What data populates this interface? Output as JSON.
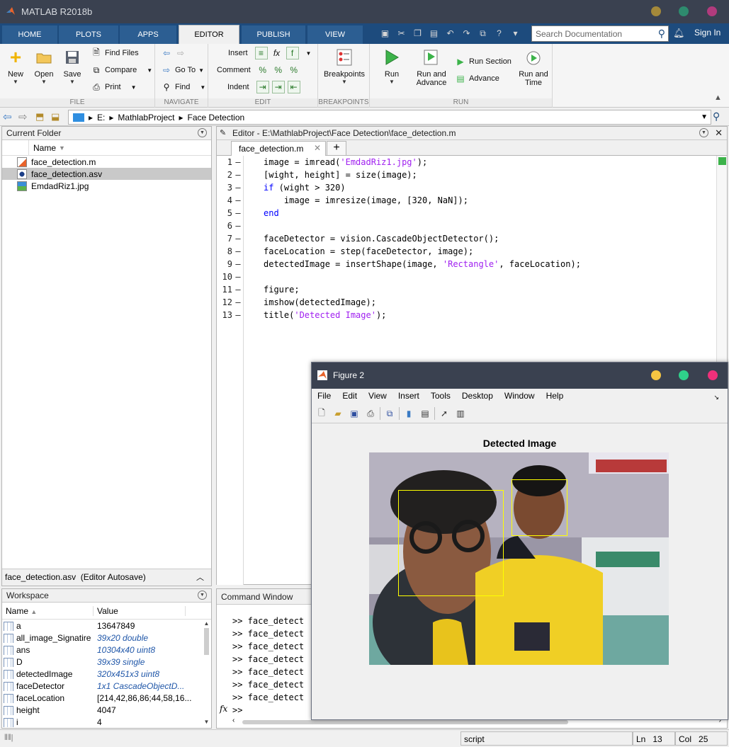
{
  "app": {
    "title": "MATLAB R2018b",
    "window_controls": [
      "#a4893a",
      "#2e8b6e",
      "#b13b7d"
    ]
  },
  "tabs": [
    {
      "label": "HOME"
    },
    {
      "label": "PLOTS"
    },
    {
      "label": "APPS"
    },
    {
      "label": "EDITOR",
      "active": true
    },
    {
      "label": "PUBLISH"
    },
    {
      "label": "VIEW"
    }
  ],
  "search": {
    "placeholder": "Search Documentation"
  },
  "signin": "Sign In",
  "ribbon": {
    "file": {
      "label": "FILE",
      "new": "New",
      "open": "Open",
      "save": "Save",
      "find_files": "Find Files",
      "compare": "Compare",
      "print": "Print"
    },
    "navigate": {
      "label": "NAVIGATE",
      "go_to": "Go To",
      "find": "Find"
    },
    "edit": {
      "label": "EDIT",
      "insert": "Insert",
      "comment": "Comment",
      "indent": "Indent"
    },
    "breakpoints": {
      "label": "BREAKPOINTS",
      "button": "Breakpoints"
    },
    "run": {
      "label": "RUN",
      "run": "Run",
      "run_and_advance": [
        "Run and",
        "Advance"
      ],
      "run_section": "Run Section",
      "advance": "Advance",
      "run_and_time": [
        "Run and",
        "Time"
      ]
    }
  },
  "address": {
    "drive": "E:",
    "folder1": "MathlabProject",
    "folder2": "Face Detection"
  },
  "current_folder": {
    "title": "Current Folder",
    "column": "Name",
    "files": [
      {
        "name": "face_detection.m",
        "selected": false
      },
      {
        "name": "face_detection.asv",
        "selected": true
      },
      {
        "name": "EmdadRiz1.jpg",
        "selected": false
      }
    ],
    "details": "face_detection.asv  (Editor Autosave)"
  },
  "editor": {
    "title": "Editor - E:\\MathlabProject\\Face Detection\\face_detection.m",
    "tab": "face_detection.m",
    "lines": [
      {
        "no": "1",
        "parts": [
          [
            "",
            "image = imread("
          ],
          [
            "str",
            "'EmdadRiz1.jpg'"
          ],
          [
            "",
            ");"
          ]
        ]
      },
      {
        "no": "2",
        "parts": [
          [
            "",
            "[wight, height] = size(image);"
          ]
        ]
      },
      {
        "no": "3",
        "parts": [
          [
            "kw",
            "if"
          ],
          [
            "",
            " (wight > 320)"
          ]
        ]
      },
      {
        "no": "4",
        "parts": [
          [
            "",
            "    image = imresize(image, [320, NaN]);"
          ]
        ]
      },
      {
        "no": "5",
        "parts": [
          [
            "kw",
            "end"
          ]
        ]
      },
      {
        "no": "6",
        "parts": [
          [
            "",
            ""
          ]
        ]
      },
      {
        "no": "7",
        "parts": [
          [
            "",
            "faceDetector = vision.CascadeObjectDetector();"
          ]
        ]
      },
      {
        "no": "8",
        "parts": [
          [
            "",
            "faceLocation = step(faceDetector, image);"
          ]
        ]
      },
      {
        "no": "9",
        "parts": [
          [
            "",
            "detectedImage = insertShape(image, "
          ],
          [
            "str",
            "'Rectangle'"
          ],
          [
            "",
            ", faceLocation);"
          ]
        ]
      },
      {
        "no": "10",
        "parts": [
          [
            "",
            ""
          ]
        ]
      },
      {
        "no": "11",
        "parts": [
          [
            "",
            "figure;"
          ]
        ]
      },
      {
        "no": "12",
        "parts": [
          [
            "",
            "imshow(detectedImage);"
          ]
        ]
      },
      {
        "no": "13",
        "parts": [
          [
            "",
            "title("
          ],
          [
            "str",
            "'Detected Image'"
          ],
          [
            "",
            ");"
          ]
        ]
      }
    ]
  },
  "workspace": {
    "title": "Workspace",
    "col_name": "Name",
    "col_value": "Value",
    "rows": [
      {
        "name": "a",
        "value": "13647849",
        "italic": false
      },
      {
        "name": "all_image_Signatire",
        "value": "39x20 double",
        "italic": true
      },
      {
        "name": "ans",
        "value": "10304x40 uint8",
        "italic": true
      },
      {
        "name": "D",
        "value": "39x39 single",
        "italic": true
      },
      {
        "name": "detectedImage",
        "value": "320x451x3 uint8",
        "italic": true
      },
      {
        "name": "faceDetector",
        "value": "1x1 CascadeObjectD...",
        "italic": true
      },
      {
        "name": "faceLocation",
        "value": "[214,42,86,86;44,58,16...",
        "italic": false
      },
      {
        "name": "height",
        "value": "4047",
        "italic": false
      },
      {
        "name": "i",
        "value": "4",
        "italic": false
      }
    ]
  },
  "command_window": {
    "title": "Command Window",
    "lines": [
      ">> face_detect",
      ">> face_detect",
      ">> face_detect",
      ">> face_detect",
      ">> face_detect",
      ">> face_detect",
      ">> face_detect"
    ],
    "prompt": ">>"
  },
  "status": {
    "mode": "script",
    "ln_label": "Ln",
    "ln": "13",
    "col_label": "Col",
    "col": "25"
  },
  "figure": {
    "title": "Figure 2",
    "menu": [
      "File",
      "Edit",
      "View",
      "Insert",
      "Tools",
      "Desktop",
      "Window",
      "Help"
    ],
    "axes_title": "Detected Image",
    "window_controls": [
      "#f5c542",
      "#2fd08a",
      "#f0307a"
    ]
  }
}
